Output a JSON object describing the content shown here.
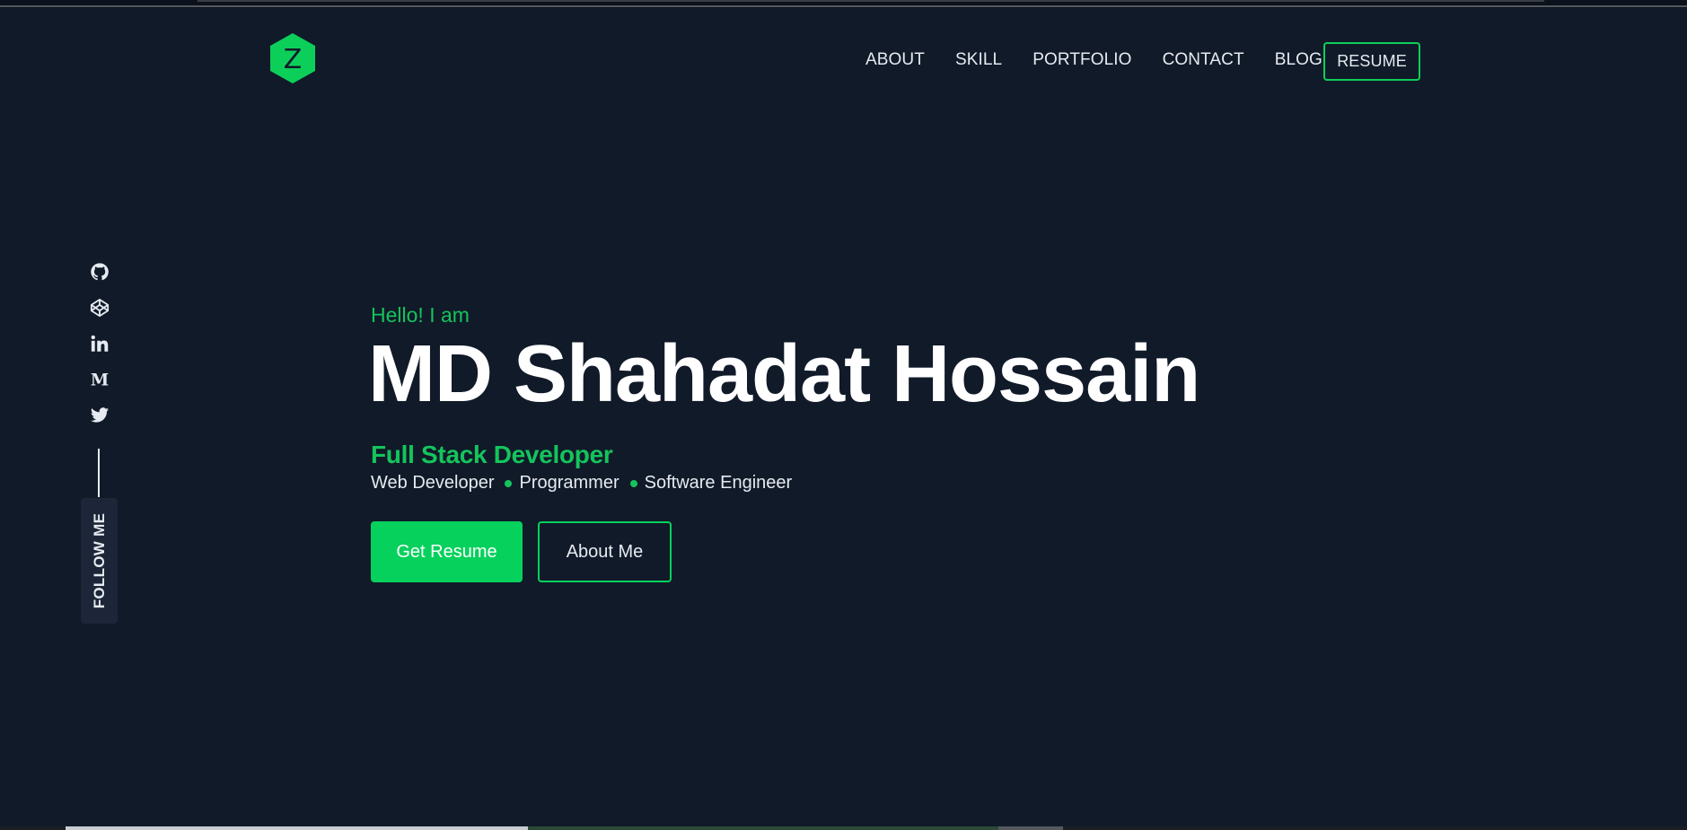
{
  "logo": {
    "letter": "Z",
    "icon": "hexagon-logo-icon",
    "color": "#0ccf5a"
  },
  "nav": {
    "items": [
      {
        "label": "ABOUT"
      },
      {
        "label": "SKILL"
      },
      {
        "label": "PORTFOLIO"
      },
      {
        "label": "CONTACT"
      },
      {
        "label": "BLOG"
      }
    ],
    "resume_label": "RESUME"
  },
  "social": {
    "icons": [
      "github-icon",
      "codepen-icon",
      "linkedin-icon",
      "medium-icon",
      "twitter-icon"
    ],
    "follow_label": "FOLLOW ME"
  },
  "hero": {
    "greeting": "Hello! I am",
    "name": "MD Shahadat Hossain",
    "role": "Full Stack Developer",
    "tags": [
      "Web Developer",
      "Programmer",
      "Software Engineer"
    ],
    "primary_button": "Get Resume",
    "secondary_button": "About Me"
  },
  "colors": {
    "background": "#111a29",
    "accent": "#06d15d",
    "text": "#e6ebf1"
  }
}
